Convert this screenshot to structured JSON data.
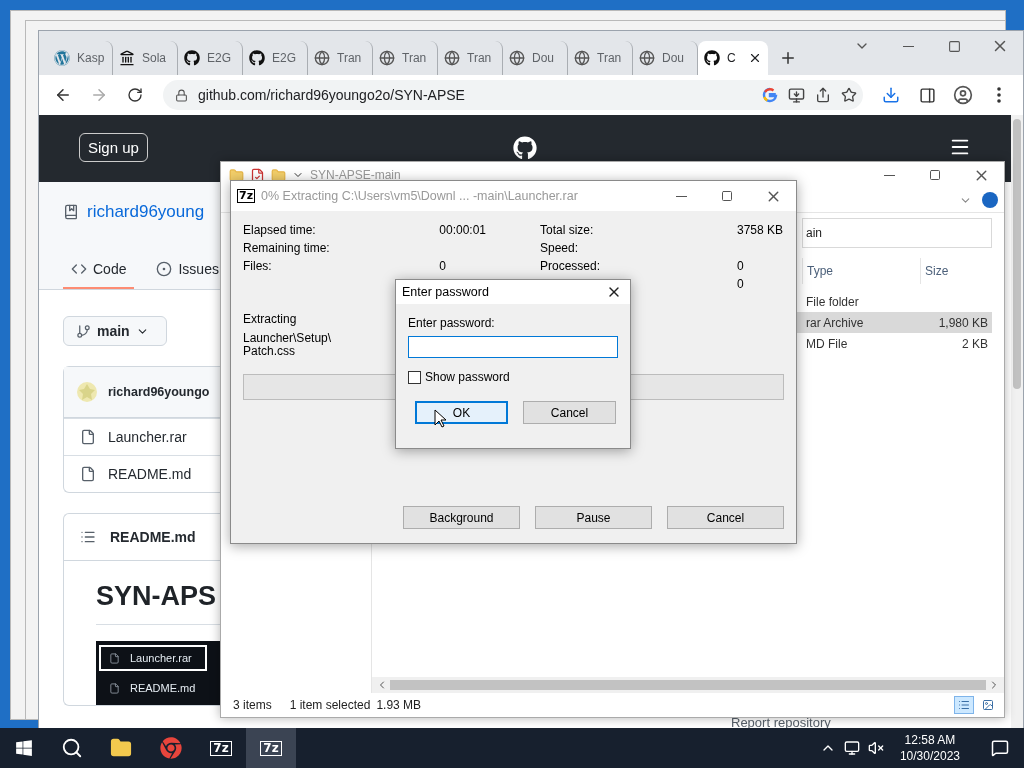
{
  "browser": {
    "tabs": [
      {
        "kind": "wordpress",
        "label": "Kasp",
        "selected": false
      },
      {
        "kind": "bank",
        "label": "Sola",
        "selected": false
      },
      {
        "kind": "github",
        "label": "E2G",
        "selected": false
      },
      {
        "kind": "github",
        "label": "E2G",
        "selected": false
      },
      {
        "kind": "globe",
        "label": "Tran",
        "selected": false
      },
      {
        "kind": "globe",
        "label": "Tran",
        "selected": false
      },
      {
        "kind": "globe",
        "label": "Tran",
        "selected": false
      },
      {
        "kind": "globe",
        "label": "Dou",
        "selected": false
      },
      {
        "kind": "globe",
        "label": "Tran",
        "selected": false
      },
      {
        "kind": "globe",
        "label": "Dou",
        "selected": false
      },
      {
        "kind": "github",
        "label": "C",
        "selected": true
      }
    ],
    "url": "github.com/richard96youngo2o/SYN-APSE",
    "page": {
      "sign_up": "Sign up",
      "repo_name": "richard96young",
      "nav_tabs": [
        {
          "kind": "code",
          "label": "Code",
          "selected": true
        },
        {
          "kind": "issue",
          "label": "Issues",
          "selected": false
        }
      ],
      "branch": "main",
      "commit_author": "richard96youngo",
      "files": [
        "Launcher.rar",
        "README.md"
      ],
      "readme_title": "README.md",
      "readme_heading": "SYN-APS",
      "readme_image_files": [
        {
          "label": "Launcher.rar",
          "selected": true
        },
        {
          "label": "README.md",
          "selected": false
        }
      ],
      "sidebar_link": "Report repository"
    }
  },
  "explorer": {
    "title": "SYN-APSE-main",
    "address": "ain",
    "columns": [
      "Type",
      "Size"
    ],
    "rows": [
      {
        "type": "File folder",
        "selected": false
      },
      {
        "type": "rar Archive",
        "size": "1,980 KB",
        "selected": true
      },
      {
        "type": "MD File",
        "size": "2 KB",
        "selected": false
      }
    ],
    "status": {
      "count": "3 items",
      "selection": "1 item selected",
      "size": "1.93 MB"
    }
  },
  "extract_dialog": {
    "icon_text": "7z",
    "title": "0% Extracting C:\\Users\\vm5\\Downl ... -main\\Launcher.rar",
    "stats_left": [
      {
        "label": "Elapsed time:",
        "value": "00:00:01"
      },
      {
        "label": "Remaining time:"
      },
      {
        "label": "Files:",
        "value": "0"
      }
    ],
    "stats_right": [
      {
        "label": "Total size:",
        "value": "3758 KB"
      },
      {
        "label": "Speed:"
      },
      {
        "label": "Processed:",
        "value": "0"
      },
      {
        "value": "0"
      }
    ],
    "extracting_label": "Extracting",
    "path_lines": [
      "Launcher\\Setup\\",
      "Patch.css"
    ],
    "progress": {
      "level": 0
    },
    "buttons": [
      "Background",
      "Pause",
      "Cancel"
    ]
  },
  "password_dialog": {
    "title": "Enter password",
    "prompt": "Enter password:",
    "show_password": {
      "label": "Show password",
      "checked": false
    },
    "buttons": [
      {
        "label": "OK",
        "default": true
      },
      {
        "label": "Cancel",
        "default": false
      }
    ]
  },
  "taskbar": {
    "apps": [
      {
        "kind": "explorer",
        "selected": false
      },
      {
        "kind": "chrome",
        "selected": false
      },
      {
        "kind": "sevenzip",
        "label": "7z",
        "selected": false
      },
      {
        "kind": "sevenzip",
        "label": "7z",
        "selected": true
      }
    ],
    "time": "12:58 AM",
    "date": "10/30/2023"
  }
}
